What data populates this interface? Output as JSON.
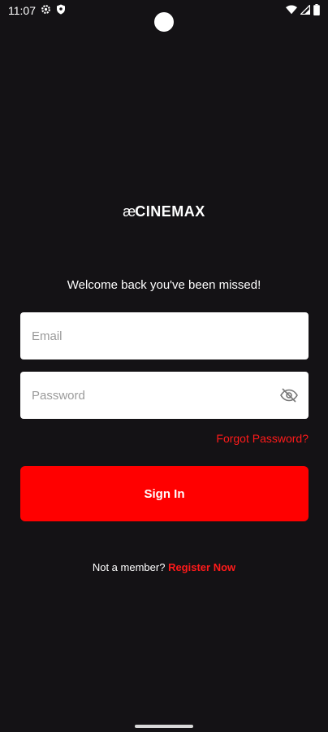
{
  "status_bar": {
    "time": "11:07",
    "icons_left": [
      "gear-icon",
      "shield-icon"
    ],
    "icons_right": [
      "wifi-icon",
      "signal-icon",
      "battery-icon"
    ]
  },
  "brand": {
    "logo_mark": "æ",
    "logo_text": "CINEMAX"
  },
  "login": {
    "welcome": "Welcome back you've been missed!",
    "email_placeholder": "Email",
    "email_value": "",
    "password_placeholder": "Password",
    "password_value": "",
    "forgot_label": "Forgot Password?",
    "signin_label": "Sign In",
    "register_prompt": "Not a member?",
    "register_link": "Register Now"
  },
  "colors": {
    "background": "#141215",
    "accent": "#ff0000",
    "link": "#ff1a1a",
    "field_bg": "#ffffff"
  }
}
